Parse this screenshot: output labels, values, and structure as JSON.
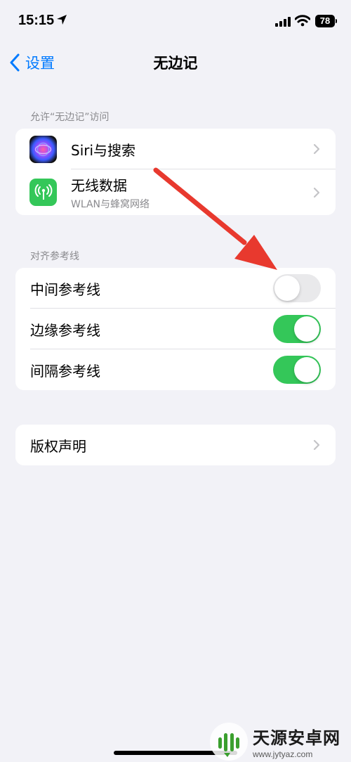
{
  "status_bar": {
    "time": "15:15",
    "battery": "78"
  },
  "nav": {
    "back_label": "设置",
    "title": "无边记"
  },
  "access_section": {
    "header": "允许“无边记”访问",
    "items": [
      {
        "label": "Siri与搜索",
        "icon": "siri-icon"
      },
      {
        "label": "无线数据",
        "sublabel": "WLAN与蜂窝网络",
        "icon": "antenna-icon"
      }
    ]
  },
  "guides_section": {
    "header": "对齐参考线",
    "items": [
      {
        "label": "中间参考线",
        "on": false
      },
      {
        "label": "边缘参考线",
        "on": true
      },
      {
        "label": "间隔参考线",
        "on": true
      }
    ]
  },
  "copyright": {
    "label": "版权声明"
  },
  "watermark": {
    "name": "天源安卓网",
    "url": "www.jytyaz.com"
  },
  "colors": {
    "accent": "#007aff",
    "toggle_on": "#34c759",
    "toggle_off": "#e9e9eb",
    "background": "#f2f2f7",
    "annotation_arrow": "#e8392e"
  }
}
